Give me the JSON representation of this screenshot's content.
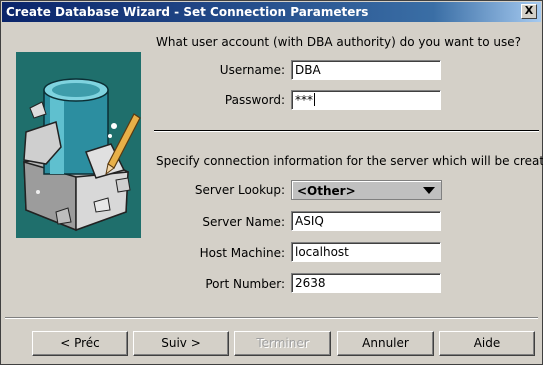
{
  "window": {
    "title": "Create Database Wizard  -  Set Connection Parameters",
    "close_label": "X"
  },
  "account_section": {
    "question": "What user account (with DBA authority) do you want to use?",
    "username_label": "Username:",
    "username_value": "DBA",
    "password_label": "Password:",
    "password_value": "***"
  },
  "server_section": {
    "question": "Specify connection information for the server which will be created.",
    "server_lookup_label": "Server Lookup:",
    "server_lookup_value": "<Other>",
    "server_name_label": "Server Name:",
    "server_name_value": "ASIQ",
    "host_machine_label": "Host Machine:",
    "host_machine_value": "localhost",
    "port_number_label": "Port Number:",
    "port_number_value": "2638"
  },
  "buttons": {
    "back": "< Préc",
    "next": "Suiv >",
    "finish": "Terminer",
    "cancel": "Annuler",
    "help": "Aide"
  },
  "illustration": {
    "icon": "database-cylinder-breaking-box-icon",
    "colors": {
      "background": "#1f6f6c",
      "cylinder": "#3f9fb0",
      "box": "#c8c8c8"
    }
  }
}
